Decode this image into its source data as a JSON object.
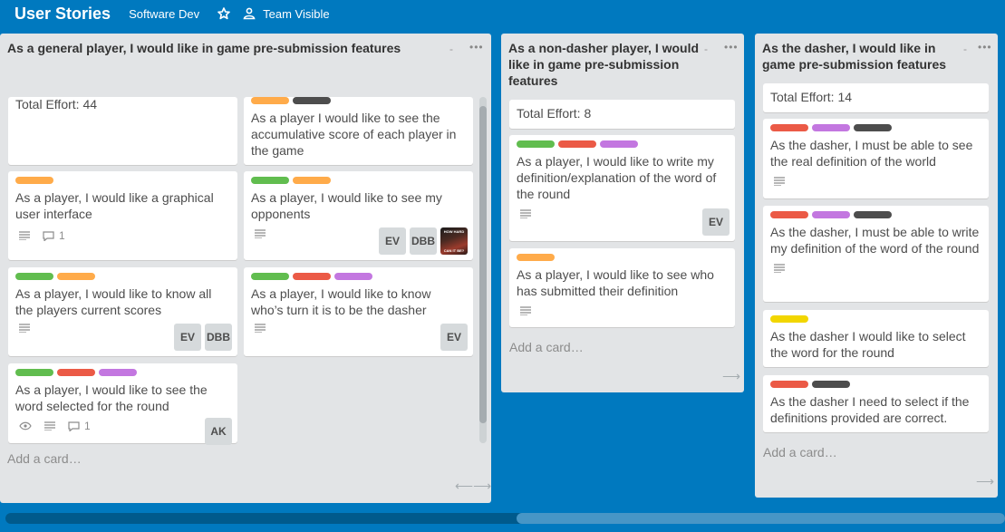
{
  "header": {
    "title": "User Stories",
    "org": "Software Dev",
    "star_icon": "star-icon",
    "visibility_icon": "team-icon",
    "visibility": "Team Visible"
  },
  "colors": {
    "green": "#61bd4f",
    "orange": "#ffab4a",
    "red": "#eb5a46",
    "purple": "#c377e0",
    "black": "#4d4d4d",
    "yellow": "#f2d600"
  },
  "lists": [
    {
      "title": "As a general player, I would like in game pre-submission features",
      "add_card": "Add a card…",
      "cards": [
        {
          "title": "Total Effort: 44"
        },
        {
          "title": "As a player I would like to see the accumulative score of each player in the game",
          "labels": [
            "orange",
            "black"
          ]
        },
        {
          "title": "As a player, I would like a graphical user interface",
          "labels": [
            "orange"
          ],
          "comments": "1"
        },
        {
          "title": "As a player, I would like to see my opponents",
          "labels": [
            "green",
            "orange"
          ],
          "members": [
            "EV",
            "DBB"
          ],
          "avatar_text": [
            "HOW HARD",
            "CAN IT BE?"
          ]
        },
        {
          "title": "As a player, I would like to know all the players current scores",
          "labels": [
            "green",
            "orange"
          ],
          "members": [
            "EV",
            "DBB"
          ]
        },
        {
          "title": "As a player, I would like to know who’s turn it is to be the dasher",
          "labels": [
            "green",
            "red",
            "purple"
          ],
          "members": [
            "EV"
          ]
        },
        {
          "title": "As a player, I would like to see the word selected for the round",
          "labels": [
            "green",
            "red",
            "purple"
          ],
          "comments": "1",
          "members": [
            "AK"
          ]
        }
      ]
    },
    {
      "title": "As a non-dasher player, I would like in game pre-submission features",
      "add_card": "Add a card…",
      "cards": [
        {
          "title": "Total Effort: 8"
        },
        {
          "title": "As a player, I would like to write my definition/explanation of the word of the round",
          "labels": [
            "green",
            "red",
            "purple"
          ],
          "members": [
            "EV"
          ]
        },
        {
          "title": "As a player, I would like to see who has submitted their definition",
          "labels": [
            "orange"
          ]
        }
      ]
    },
    {
      "title": "As the dasher, I would like in game pre-submission features",
      "add_card": "Add a card…",
      "cards": [
        {
          "title": "Total Effort: 14"
        },
        {
          "title": "As the dasher, I must be able to see the real definition of the world",
          "labels": [
            "red",
            "purple",
            "black"
          ]
        },
        {
          "title": "As the dasher, I must be able to write my definition of the word of the round",
          "labels": [
            "red",
            "purple",
            "black"
          ]
        },
        {
          "title": "As the dasher I would like to select the word for the round",
          "labels": [
            "yellow"
          ]
        },
        {
          "title": "As the dasher I need to select if the definitions provided are correct.",
          "labels": [
            "red",
            "black"
          ]
        }
      ]
    }
  ]
}
